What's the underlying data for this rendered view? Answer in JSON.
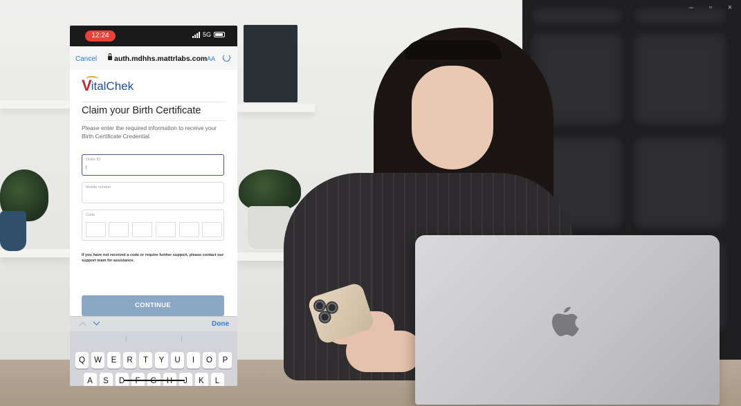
{
  "window_controls": {
    "minimize": "–",
    "restore": "▫",
    "close": "×"
  },
  "status_bar": {
    "time": "12:24",
    "network": "5G"
  },
  "browser": {
    "cancel_label": "Cancel",
    "url": "auth.mdhhs.mattrlabs.com",
    "text_size_label": "AA"
  },
  "brand": {
    "logo_initial": "V",
    "logo_rest": "italChek"
  },
  "form": {
    "title": "Claim your Birth Certificate",
    "instructions": "Please enter the required information to receive your Birth Certificate Credential.",
    "order_id_label": "Order ID",
    "mobile_label": "Mobile number",
    "code_label": "Code",
    "support_text": "If you have not received a code or require further support, please contact our support team for assistance.",
    "continue_label": "CONTINUE"
  },
  "keyboard": {
    "done_label": "Done",
    "row1": [
      "Q",
      "W",
      "E",
      "R",
      "T",
      "Y",
      "U",
      "I",
      "O",
      "P"
    ],
    "row2": [
      "A",
      "S",
      "D",
      "F",
      "G",
      "H",
      "J",
      "K",
      "L"
    ]
  },
  "colors": {
    "accent_blue": "#2a7ae2",
    "continue_button": "#8aa8c6",
    "focus_border": "#4b5196",
    "brand_red": "#c8262b",
    "brand_blue": "#1c4c9c",
    "time_pill": "#e8423b"
  }
}
